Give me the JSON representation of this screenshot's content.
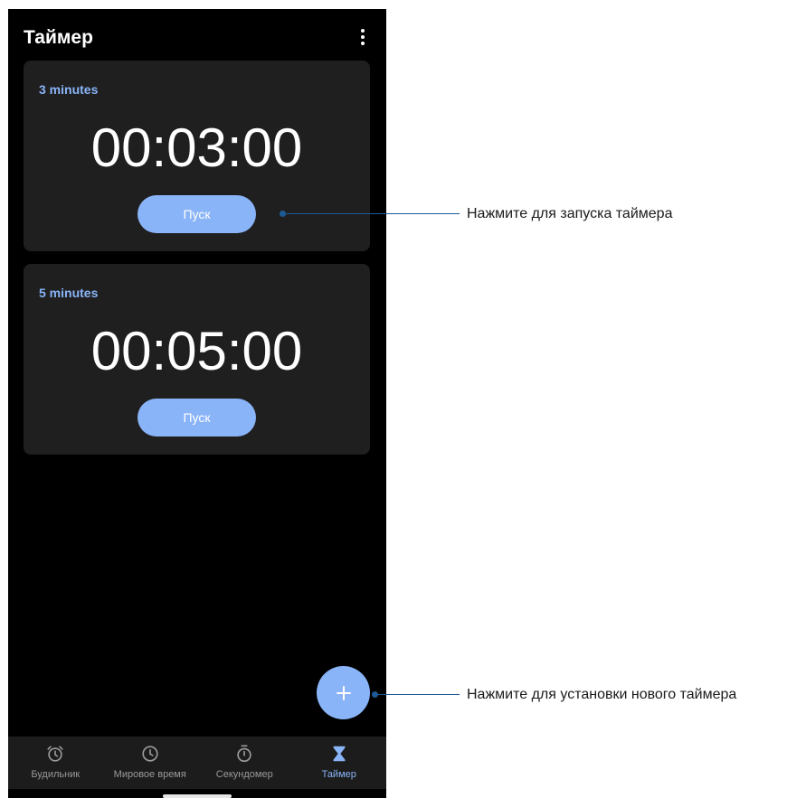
{
  "app": {
    "title": "Таймер"
  },
  "timers": [
    {
      "label": "3 minutes",
      "time": "00:03:00",
      "start_label": "Пуск"
    },
    {
      "label": "5 minutes",
      "time": "00:05:00",
      "start_label": "Пуск"
    }
  ],
  "fab": {
    "symbol": "+"
  },
  "nav": {
    "items": [
      {
        "label": "Будильник",
        "icon": "alarm-clock-icon",
        "active": false
      },
      {
        "label": "Мировое время",
        "icon": "clock-icon",
        "active": false
      },
      {
        "label": "Секундомер",
        "icon": "stopwatch-icon",
        "active": false
      },
      {
        "label": "Таймер",
        "icon": "hourglass-icon",
        "active": true
      }
    ]
  },
  "callouts": {
    "start": "Нажмите для запуска таймера",
    "new_timer": "Нажмите для установки нового таймера"
  },
  "colors": {
    "accent": "#8ab4f8",
    "background": "#000000",
    "card": "#1f1f1f",
    "callout": "#1e5a96"
  }
}
